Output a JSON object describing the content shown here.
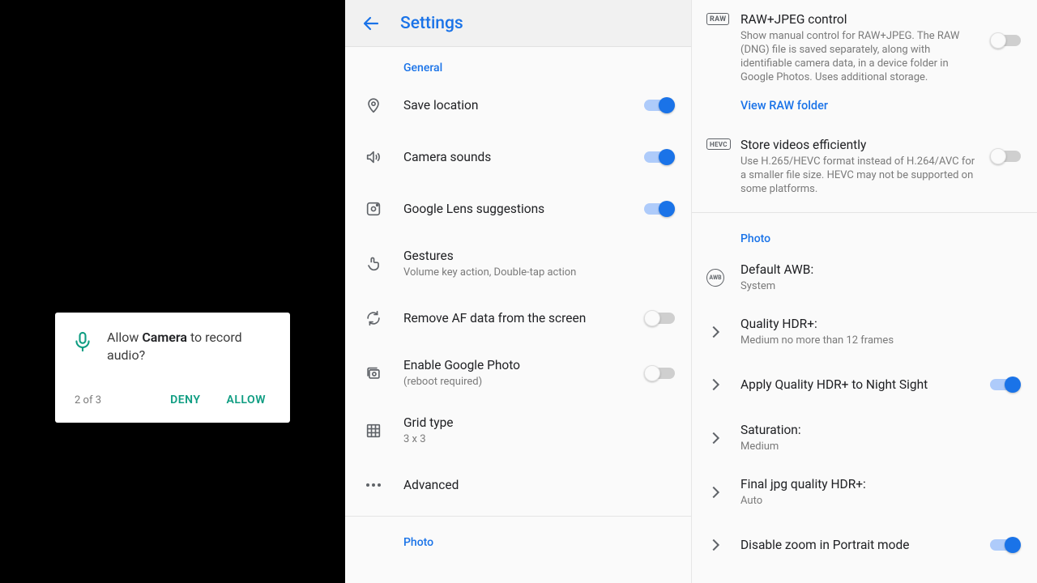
{
  "perm": {
    "before": "Allow ",
    "app": "Camera",
    "after": " to record audio?",
    "counter": "2 of 3",
    "deny": "DENY",
    "allow": "ALLOW"
  },
  "mid": {
    "title": "Settings",
    "section_general": "General",
    "section_photo": "Photo",
    "save_location": "Save location",
    "camera_sounds": "Camera sounds",
    "lens": "Google Lens suggestions",
    "gestures_title": "Gestures",
    "gestures_sub": "Volume key action, Double-tap action",
    "remove_af": "Remove AF data from the screen",
    "enable_gphoto_title": "Enable Google Photo",
    "enable_gphoto_sub": "(reboot required)",
    "grid_title": "Grid type",
    "grid_sub": "3 x 3",
    "advanced": "Advanced"
  },
  "right": {
    "raw_title": "RAW+JPEG control",
    "raw_desc": "Show manual control for RAW+JPEG. The RAW (DNG) file is saved separately, along with identifiable camera data, in a device folder in Google Photos. Uses additional storage.",
    "raw_link": "View RAW folder",
    "hevc_title": "Store videos efficiently",
    "hevc_desc": "Use H.265/HEVC format instead of H.264/AVC for a smaller file size. HEVC may not be supported on some platforms.",
    "section_photo": "Photo",
    "awb_title": "Default AWB:",
    "awb_sub": "System",
    "qhdr_title": "Quality HDR+:",
    "qhdr_sub": "Medium no more than 12 frames",
    "apply_ns": "Apply Quality HDR+ to Night Sight",
    "sat_title": "Saturation:",
    "sat_sub": "Medium",
    "jpg_title": "Final jpg quality HDR+:",
    "jpg_sub": "Auto",
    "portrait_zoom": "Disable zoom in Portrait mode",
    "badge_raw": "RAW",
    "badge_hevc": "HEVC",
    "badge_awb": "AWB"
  }
}
